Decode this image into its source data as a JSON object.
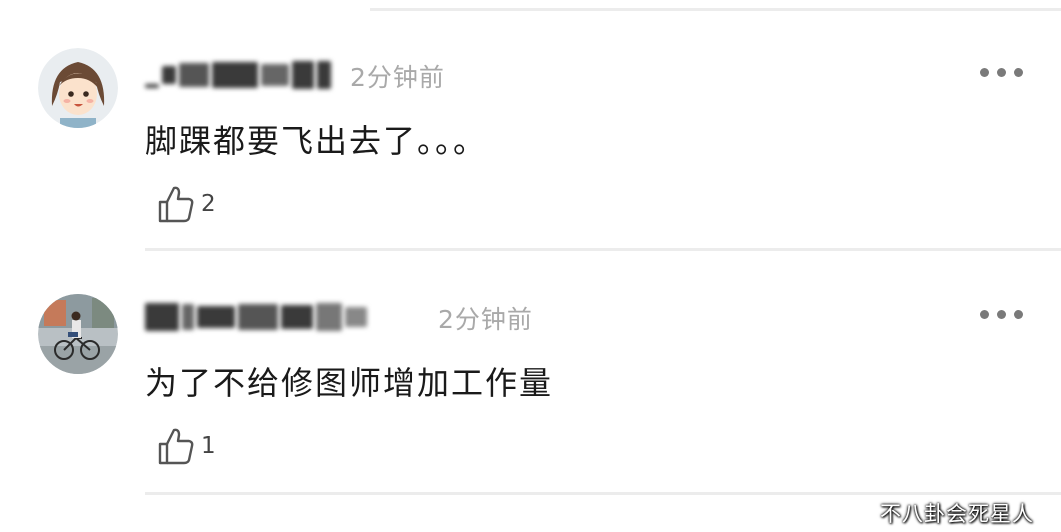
{
  "comments": [
    {
      "username": "_█ █████ █",
      "time": "2分钟前",
      "text": "脚踝都要飞出去了。。。",
      "likes": "2",
      "avatar_icon": "cartoon-girl-avatar",
      "more_icon": "ellipsis-icon"
    },
    {
      "username": "██ ███ ██ ██",
      "time": "2分钟前",
      "text": "为了不给修图师增加工作量",
      "likes": "1",
      "avatar_icon": "cyclist-photo-avatar",
      "more_icon": "ellipsis-icon"
    }
  ],
  "watermark": "不八卦会死星人"
}
